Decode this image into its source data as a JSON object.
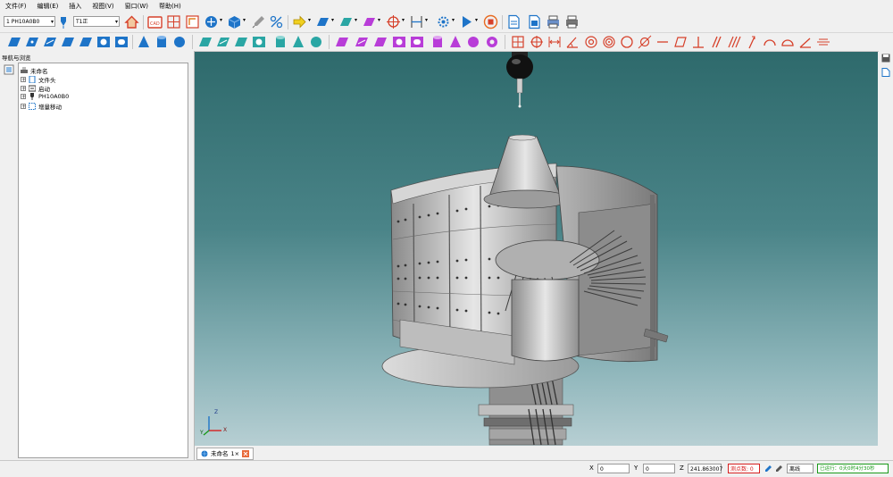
{
  "menu": [
    "文件(F)",
    "编辑(E)",
    "插入",
    "视图(V)",
    "窗口(W)",
    "帮助(H)"
  ],
  "toolbar": {
    "probe_select": "1 PH10A0B0",
    "tip_select": "T1正"
  },
  "nav": {
    "title": "导航与浏览",
    "tree": [
      {
        "label": "未命名",
        "expander": ""
      },
      {
        "label": "文件头",
        "expander": "+"
      },
      {
        "label": "启动",
        "expander": "+"
      },
      {
        "label": "PH10A0B0",
        "expander": "+"
      },
      {
        "label": "增量移动",
        "expander": "+"
      }
    ]
  },
  "viewport": {
    "axis_z": "Z",
    "axis_x": "X",
    "axis_y": "Y"
  },
  "doc_tab": {
    "label": "未命名",
    "suffix": "1×"
  },
  "status": {
    "x_label": "X",
    "x_value": "0",
    "y_label": "Y",
    "y_value": "0",
    "z_label": "Z",
    "z_value": "241.863007",
    "points_label": "测点数: 0",
    "mode_value": "离线",
    "run_label": "已运行：0天0时4分30秒"
  },
  "colors": {
    "viewport_top": "#2e6a6c",
    "viewport_bottom": "#b7cfd3",
    "toolbar_blue": "#1e74c8",
    "toolbar_teal": "#2aa6a4",
    "toolbar_purple": "#b83dd8",
    "toolbar_red": "#d6402a",
    "status_red": "#d62020",
    "status_green": "#1a9a1a"
  }
}
